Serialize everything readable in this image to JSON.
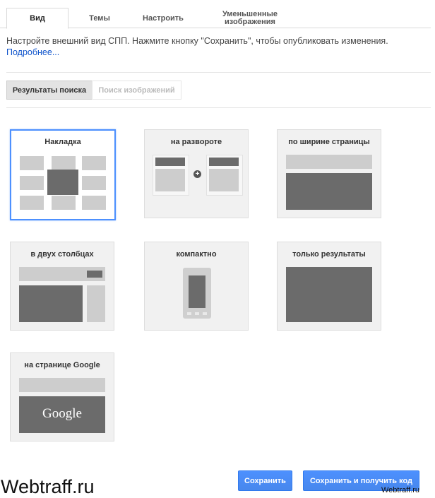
{
  "tabs": [
    {
      "label": "Вид"
    },
    {
      "label": "Темы"
    },
    {
      "label": "Настроить"
    },
    {
      "label": "Уменьшенные изображения"
    }
  ],
  "description": {
    "text": "Настройте внешний вид СПП. Нажмите кнопку \"Сохранить\", чтобы опубликовать изменения.",
    "link": "Подробнее..."
  },
  "segments": {
    "search_results": "Результаты поиска",
    "image_search": "Поиск изображений"
  },
  "layouts": [
    {
      "label": "Накладка"
    },
    {
      "label": "на развороте"
    },
    {
      "label": "по ширине страницы"
    },
    {
      "label": "в двух столбцах"
    },
    {
      "label": "компактно"
    },
    {
      "label": "только результаты"
    },
    {
      "label": "на странице Google"
    }
  ],
  "google_logo_text": "Google",
  "plus_glyph": "+",
  "buttons": {
    "save": "Сохранить",
    "save_get_code": "Сохранить и получить код"
  },
  "watermark": {
    "left": "Webtraff.ru",
    "right": "Webtraff.ru"
  },
  "colors": {
    "accent": "#4d90fe",
    "link": "#1155cc"
  }
}
